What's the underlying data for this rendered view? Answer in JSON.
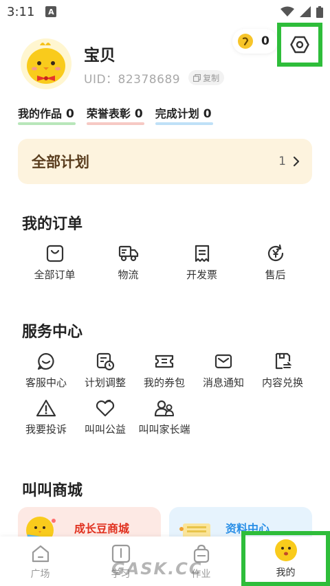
{
  "status_bar": {
    "time": "3:11",
    "notif_letter": "A"
  },
  "profile": {
    "name": "宝贝",
    "uid": "UID：82378689",
    "copy_label": "复制"
  },
  "coins": {
    "count": "0"
  },
  "stats": [
    {
      "label": "我的作品",
      "count": "0",
      "color": "#b8e6ba"
    },
    {
      "label": "荣誉表彰",
      "count": "0",
      "color": "#f6c9c4"
    },
    {
      "label": "完成计划",
      "count": "0",
      "color": "#bfe0f7"
    }
  ],
  "plan_card": {
    "title": "全部计划",
    "count": "1"
  },
  "orders": {
    "title": "我的订单",
    "items": [
      {
        "label": "全部订单",
        "icon": "bag-icon"
      },
      {
        "label": "物流",
        "icon": "truck-icon"
      },
      {
        "label": "开发票",
        "icon": "receipt-icon"
      },
      {
        "label": "售后",
        "icon": "yen-refresh-icon"
      }
    ]
  },
  "services": {
    "title": "服务中心",
    "items": [
      {
        "label": "客服中心",
        "icon": "chat-icon"
      },
      {
        "label": "计划调整",
        "icon": "calendar-clock-icon"
      },
      {
        "label": "我的券包",
        "icon": "ticket-icon"
      },
      {
        "label": "消息通知",
        "icon": "mail-icon"
      },
      {
        "label": "内容兑换",
        "icon": "exchange-icon"
      },
      {
        "label": "我要投诉",
        "icon": "warning-icon"
      },
      {
        "label": "叫叫公益",
        "icon": "heart-icon"
      },
      {
        "label": "叫叫家长端",
        "icon": "parents-icon"
      }
    ]
  },
  "mall": {
    "title": "叫叫商城",
    "cards": [
      {
        "label": "成长豆商城",
        "color": "#e0301e"
      },
      {
        "label": "资料中心",
        "color": "#2a8fe6"
      }
    ]
  },
  "tabbar": {
    "tabs": [
      {
        "label": "广场",
        "icon": "house-icon"
      },
      {
        "label": "学习",
        "icon": "book-icon"
      },
      {
        "label": "作业",
        "icon": "bag-icon"
      },
      {
        "label": "我的",
        "icon": "face-icon"
      }
    ]
  },
  "watermark": "GASK.CC",
  "colors": {
    "highlight": "#2ebd3a",
    "plan_bg": "#fdf3de",
    "coin": "#f7c52a"
  }
}
